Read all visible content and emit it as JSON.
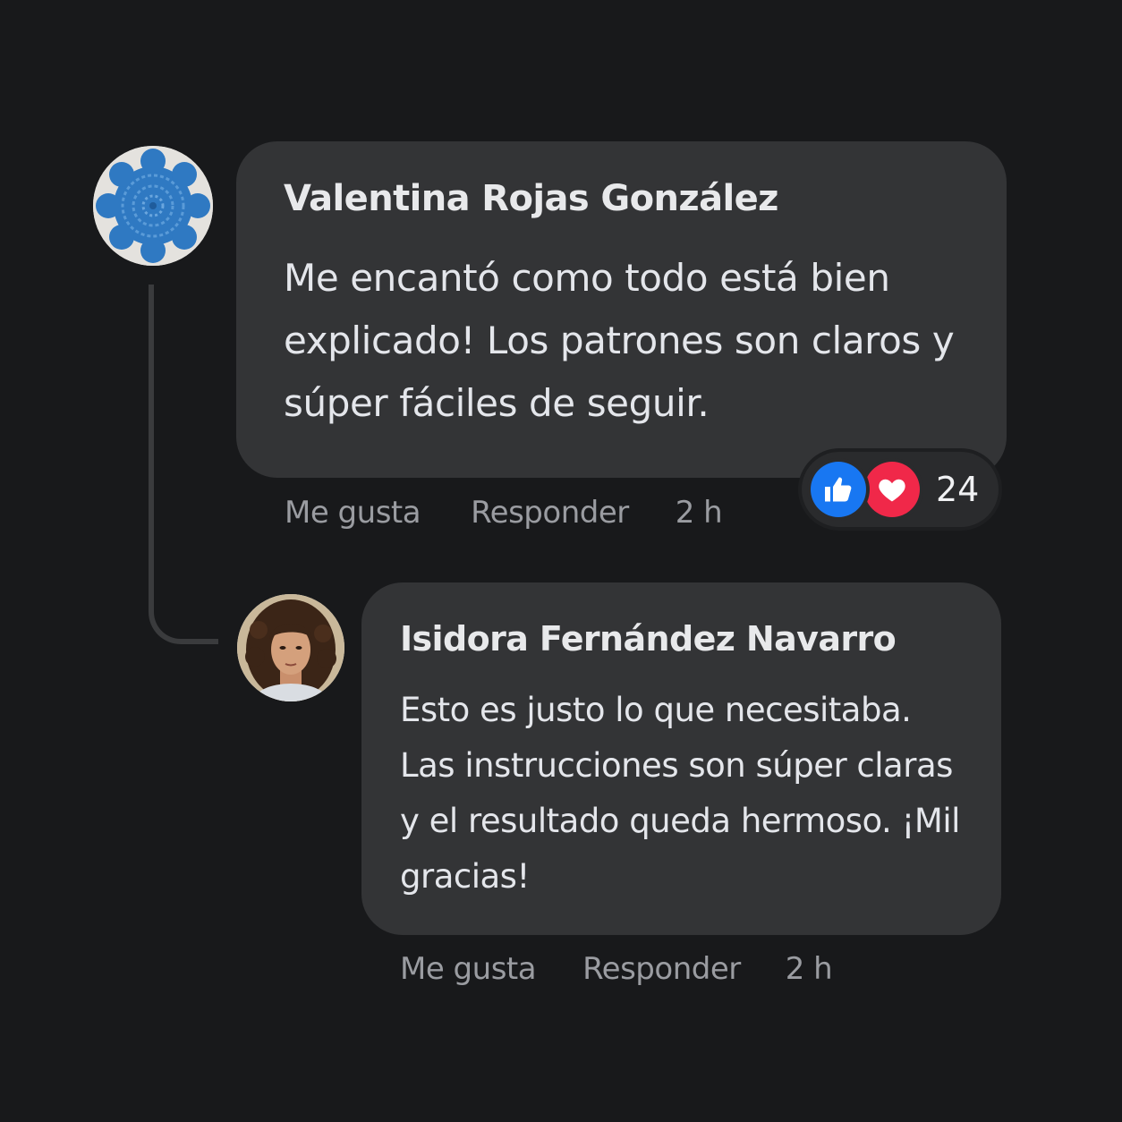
{
  "comments": [
    {
      "author": "Valentina Rojas González",
      "text": "Me encantó como todo está bien explicado! Los patrones son claros y súper fáciles de seguir.",
      "actions": {
        "like": "Me gusta",
        "reply": "Responder",
        "time": "2 h"
      },
      "reactions": {
        "icons": [
          "like-icon",
          "heart-icon"
        ],
        "count": "24"
      }
    },
    {
      "author": "Isidora Fernández Navarro",
      "text": "Esto es justo lo que necesitaba. Las instrucciones son súper claras y el resultado queda hermoso. ¡Mil gracias!",
      "actions": {
        "like": "Me gusta",
        "reply": "Responder",
        "time": "2 h"
      }
    }
  ],
  "colors": {
    "background": "#18191b",
    "bubble": "#333436",
    "like_blue": "#1877f2",
    "heart_red": "#f02849",
    "muted_text": "#9a9ca1"
  }
}
